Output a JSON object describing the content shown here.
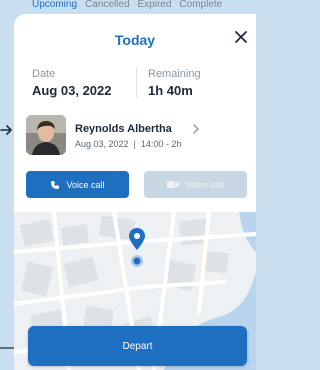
{
  "background_tabs": [
    "Upcoming",
    "Cancelled",
    "Expired",
    "Complete"
  ],
  "header": {
    "title": "Today"
  },
  "info": {
    "date_label": "Date",
    "date_value": "Aug 03, 2022",
    "remaining_label": "Remaining",
    "remaining_value": "1h 40m"
  },
  "person": {
    "name": "Reynolds Albertha",
    "meta": "Aug 03, 2022  |  14:00 - 2h"
  },
  "actions": {
    "voice_label": "Voice call",
    "video_label": "Video call"
  },
  "footer": {
    "depart_label": "Depart"
  },
  "icons": {
    "close": "close-icon",
    "chevron": "chevron-right-icon",
    "phone": "phone-icon",
    "video": "video-camera-icon",
    "pin": "location-pin-icon",
    "arrow": "arrow-right-icon"
  },
  "colors": {
    "accent": "#1f6fc0",
    "video_disabled": "#c8d7e3",
    "page_bg": "#c9dff0"
  }
}
